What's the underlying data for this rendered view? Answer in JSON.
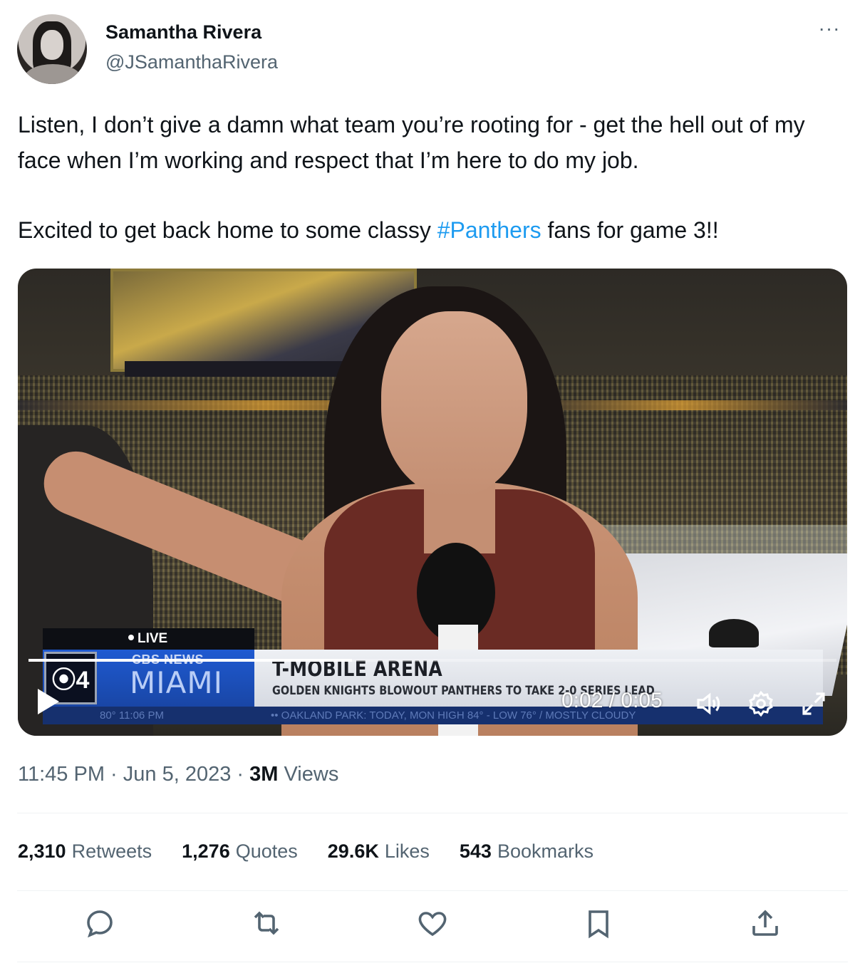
{
  "author": {
    "name": "Samantha Rivera",
    "handle": "@JSamanthaRivera"
  },
  "tweet": {
    "line1": "Listen, I don’t give a damn what team you’re rooting for - get the hell out of my face when I’m working and respect that I’m here to do my job.",
    "line2_before": "Excited to get back home to some classy ",
    "hashtag": "#Panthers",
    "line2_after": " fans for game 3!!"
  },
  "video": {
    "live_label": "LIVE",
    "station_number": "4",
    "network": "CBS NEWS",
    "city": "MIAMI",
    "headline": "T-MOBILE ARENA",
    "subheadline": "GOLDEN KNIGHTS BLOWOUT PANTHERS TO TAKE 2-0 SERIES LEAD",
    "ticker_temp": "80°   11:06 PM",
    "ticker_text": "••   OAKLAND PARK: TODAY, MON  HIGH 84° - LOW 76° / MOSTLY CLOUDY",
    "time_display": "0:02 / 0:05",
    "progress": 0.4
  },
  "meta": {
    "time": "11:45 PM",
    "date": "Jun 5, 2023",
    "views_count": "3M",
    "views_label": "Views"
  },
  "stats": [
    {
      "count": "2,310",
      "label": "Retweets"
    },
    {
      "count": "1,276",
      "label": "Quotes"
    },
    {
      "count": "29.6K",
      "label": "Likes"
    },
    {
      "count": "543",
      "label": "Bookmarks"
    }
  ],
  "icons": {
    "more": "more-icon",
    "reply": "reply-icon",
    "retweet": "retweet-icon",
    "like": "heart-icon",
    "bookmark": "bookmark-icon",
    "share": "share-icon"
  },
  "colors": {
    "link": "#1d9bf0",
    "secondary_text": "#536471",
    "primary_text": "#0f1419"
  }
}
